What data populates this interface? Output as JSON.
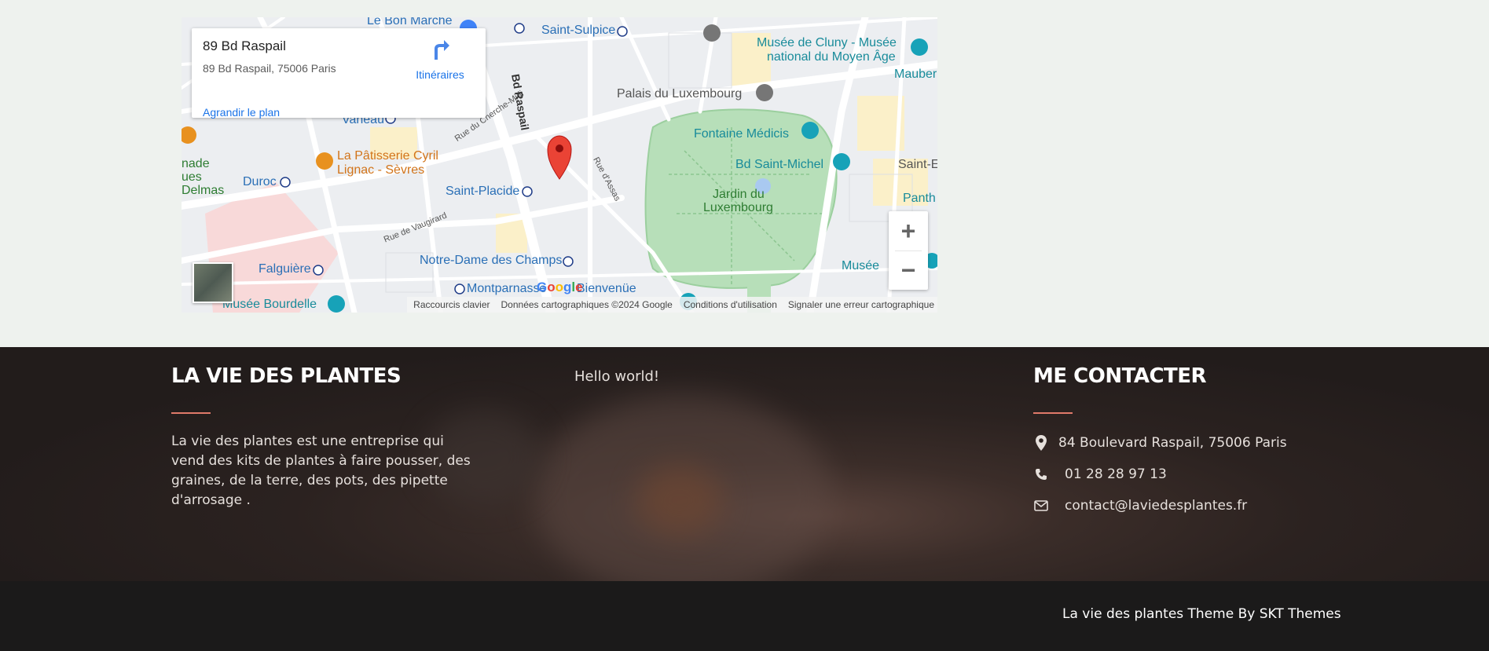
{
  "map": {
    "info_title": "89 Bd Raspail",
    "info_address": "89 Bd Raspail, 75006 Paris",
    "directions_label": "Itinéraires",
    "enlarge_link": "Agrandir le plan",
    "labels": {
      "le_bon_marche": "Le Bon Marché",
      "saint_sulpice": "Saint-Sulpice",
      "musee_cluny": "Musée de Cluny - Musée",
      "musee_cluny_2": "national du Moyen Âge",
      "maubert": "Mauber",
      "palais_luxembourg": "Palais du Luxembourg",
      "vaneau": "Vaneau",
      "rue_cherche_midi": "Rue du Cherche-Midi",
      "bd_raspail": "Bd Raspail",
      "fontaine_medicis": "Fontaine Médicis",
      "patisserie_1": "La Pâtisserie Cyril",
      "patisserie_2": "Lignac - Sèvres",
      "nade": "nade",
      "ues": "ues",
      "delmas": "Delmas",
      "duroc": "Duroc",
      "rue_assas": "Rue d'Assas",
      "bd_saint_michel": "Bd Saint-Michel",
      "saint_b": "Saint-E",
      "saint_placide": "Saint-Placide",
      "jardin_1": "Jardin du",
      "jardin_2": "Luxembourg",
      "panth": "Panth",
      "rue_vaugirard": "Rue de Vaugirard",
      "notre_dame_champs": "Notre-Dame des Champs",
      "falguiere": "Falguière",
      "musee_right": "Musée",
      "montparnasse": "Montparnasse",
      "bienvenue": "Bienvenüe",
      "musee_bourdelle": "Musée Bourdelle"
    },
    "zoom_in": "+",
    "zoom_out": "−",
    "google_logo": "Google",
    "attribution": {
      "shortcuts": "Raccourcis clavier",
      "data": "Données cartographiques ©2024 Google",
      "terms": "Conditions d'utilisation",
      "report": "Signaler une erreur cartographique"
    }
  },
  "footer": {
    "about_title": "LA VIE DES PLANTES",
    "about_text": "La vie des plantes est une entreprise qui vend des kits de plantes à faire pousser, des graines, de la terre, des pots, des pipette d'arrosage .",
    "middle_link": "Hello world!",
    "contact_title": "ME CONTACTER",
    "address": "84 Boulevard Raspail, 75006 Paris",
    "phone": "01 28 28 97 13",
    "email": "contact@laviedesplantes.fr",
    "credit": "La vie des plantes Theme By SKT Themes"
  },
  "icons": {
    "map_pin": "location-pin-icon",
    "directions": "directions-icon",
    "phone": "phone-icon",
    "email": "envelope-icon"
  },
  "colors": {
    "accent_rule": "#e07a6a",
    "footer_bg": "#2b2220",
    "bottom_bar": "#1b1a1a",
    "link_blue": "#1a73e8",
    "marker_red": "#ea4335",
    "park_green": "#b7dfb9"
  }
}
